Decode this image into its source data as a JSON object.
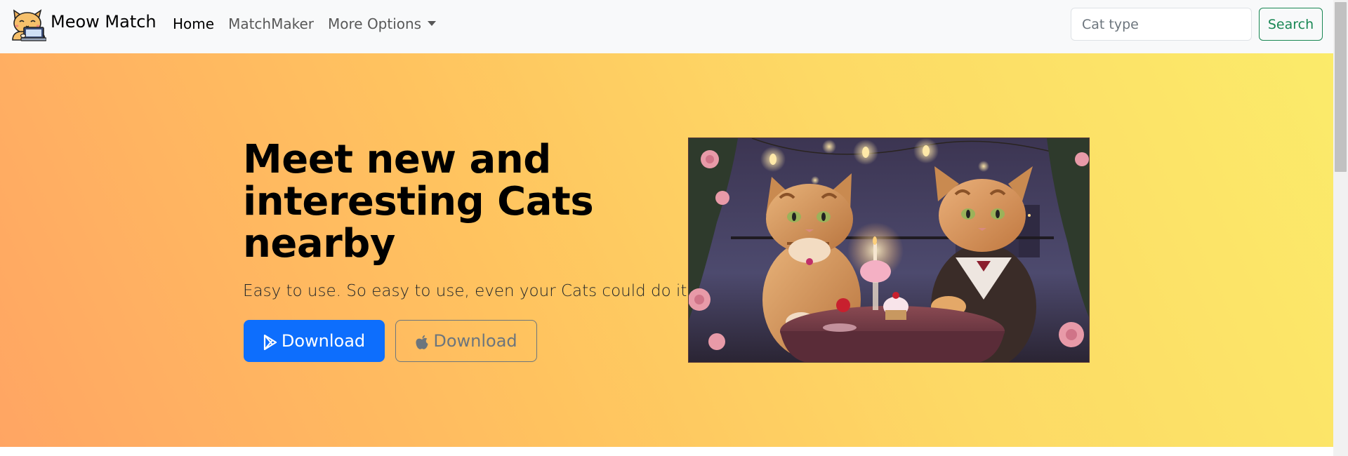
{
  "navbar": {
    "brand": "Meow Match",
    "links": [
      {
        "label": "Home",
        "active": true
      },
      {
        "label": "MatchMaker",
        "active": false
      },
      {
        "label": "More Options",
        "active": false
      }
    ],
    "search": {
      "placeholder": "Cat type",
      "button_label": "Search"
    }
  },
  "hero": {
    "title": "Meet new and interesting Cats nearby",
    "lead": "Easy to use. So easy to use, even your Cats could do it.",
    "primary_button": {
      "label": "Download",
      "icon": "google-play-icon"
    },
    "secondary_button": {
      "label": "Download",
      "icon": "apple-icon"
    },
    "image": "two-cats-candlelit-date-illustration"
  },
  "colors": {
    "primary": "#0d6efd",
    "success": "#198754",
    "secondary": "#6c757d",
    "hero_gradient_start": "#ffa563",
    "hero_gradient_end": "#fbeb6a"
  }
}
